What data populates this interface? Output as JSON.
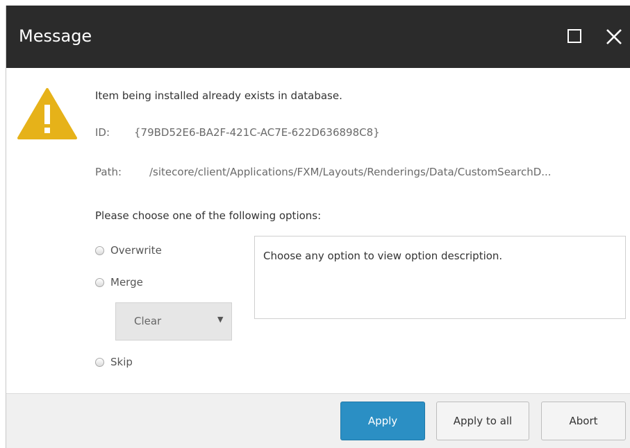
{
  "window": {
    "title": "Message",
    "title_bar_color": "#2b2b2b",
    "maximize_icon": "maximize-icon",
    "close_icon": "close-icon"
  },
  "warning": {
    "icon": "warning-icon",
    "color": "#e6b219",
    "message": "Item being installed already exists in database.",
    "id_label": "ID:",
    "id_value": "{79BD52E6-BA2F-421C-AC7E-622D636898C8}",
    "path_label": "Path:",
    "path_value": "/sitecore/client/Applications/FXM/Layouts/Renderings/Data/CustomSearchD..."
  },
  "options": {
    "prompt": "Please choose one of the following options:",
    "overwrite_label": "Overwrite",
    "merge_label": "Merge",
    "merge_mode_selected": "Clear",
    "skip_label": "Skip",
    "description": "Choose any option to view option description."
  },
  "buttons": {
    "apply": "Apply",
    "apply_to_all": "Apply to all",
    "abort": "Abort",
    "primary_color": "#2b8fc4"
  }
}
